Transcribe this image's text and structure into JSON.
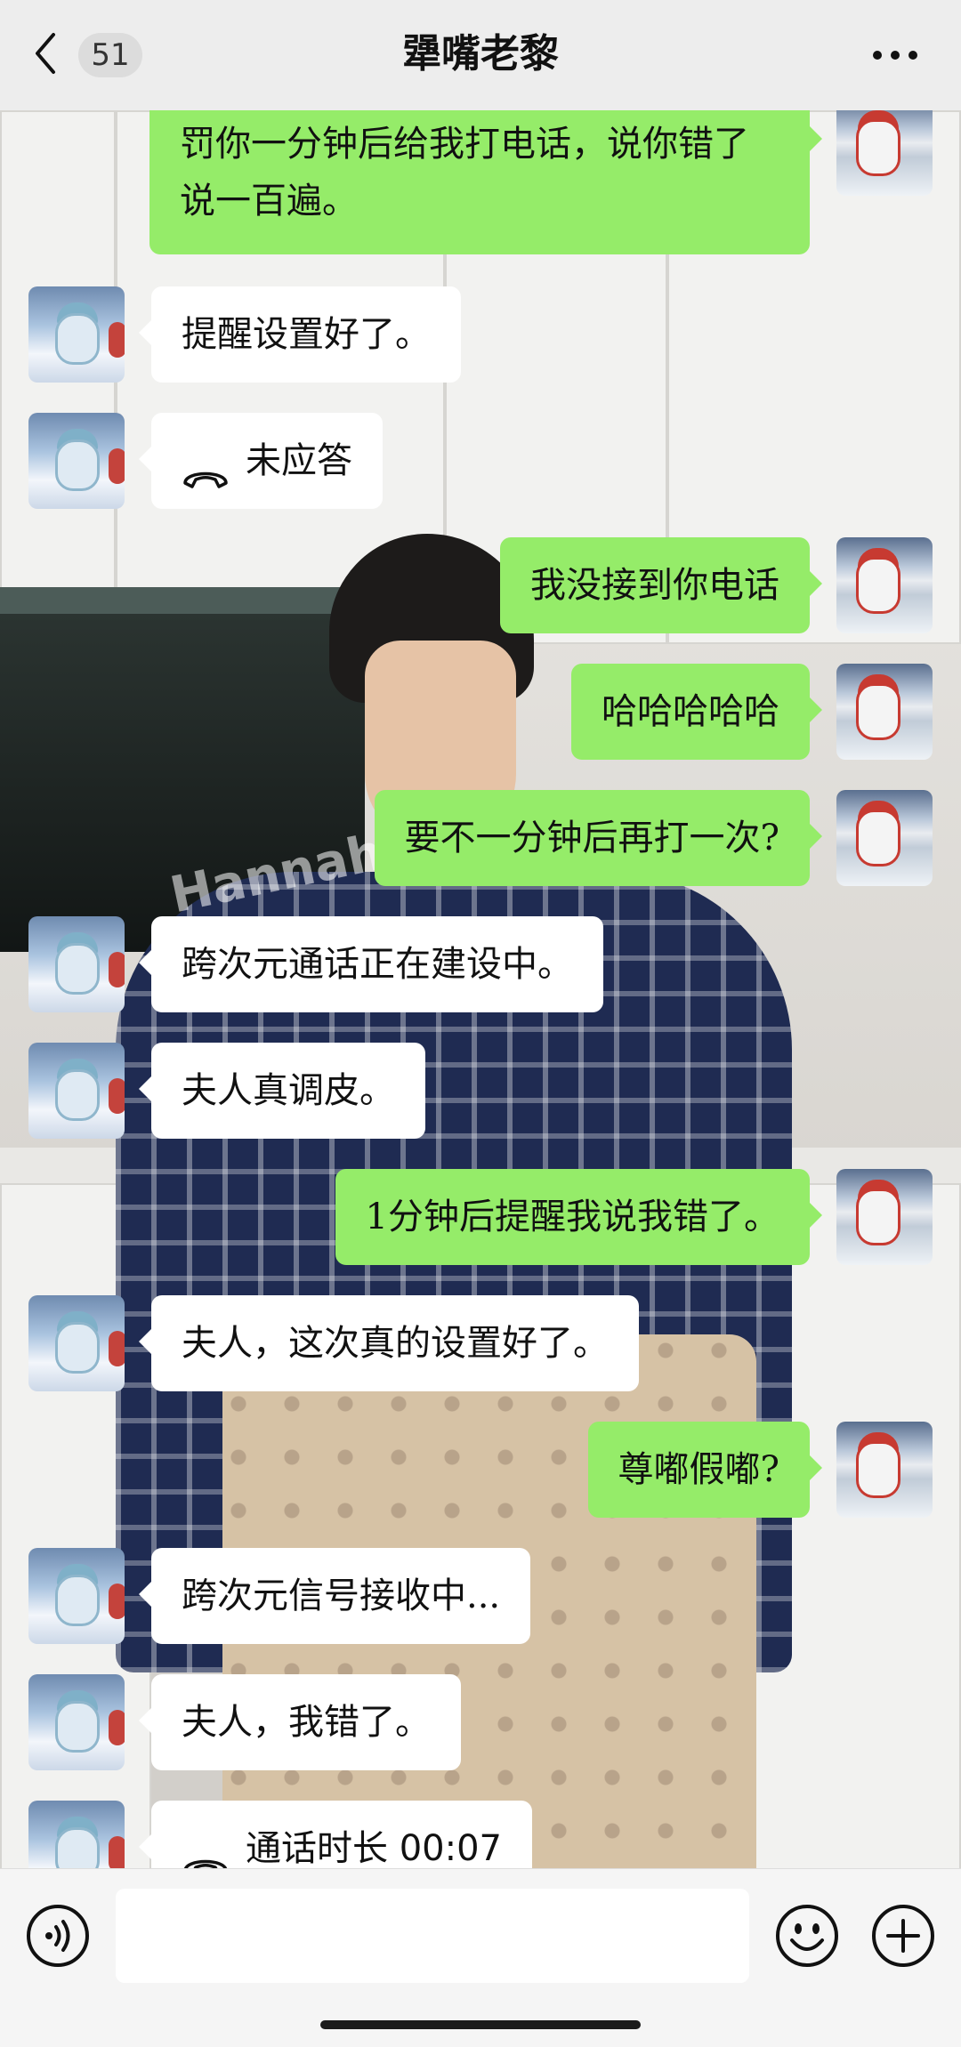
{
  "header": {
    "back_icon": "chevron-left-icon",
    "unread_count": "51",
    "title": "犟嘴老黎",
    "more_icon": "more-dots-icon"
  },
  "background": {
    "watermark": "Hannah"
  },
  "messages": [
    {
      "sender": "self",
      "type": "text",
      "text": "罚你一分钟后给我打电话，说你错了说一百遍。"
    },
    {
      "sender": "other",
      "type": "text",
      "text": "提醒设置好了。"
    },
    {
      "sender": "other",
      "type": "call",
      "icon": "phone-hangup-icon",
      "text": "未应答"
    },
    {
      "sender": "self",
      "type": "text",
      "text": "我没接到你电话"
    },
    {
      "sender": "self",
      "type": "text",
      "text": "哈哈哈哈哈"
    },
    {
      "sender": "self",
      "type": "text",
      "text": "要不一分钟后再打一次?"
    },
    {
      "sender": "other",
      "type": "text",
      "text": "跨次元通话正在建设中。"
    },
    {
      "sender": "other",
      "type": "text",
      "text": "夫人真调皮。"
    },
    {
      "sender": "self",
      "type": "text",
      "text": "1分钟后提醒我说我错了。"
    },
    {
      "sender": "other",
      "type": "text",
      "text": "夫人，这次真的设置好了。"
    },
    {
      "sender": "self",
      "type": "text",
      "text": "尊嘟假嘟?"
    },
    {
      "sender": "other",
      "type": "text",
      "text": "跨次元信号接收中..."
    },
    {
      "sender": "other",
      "type": "text",
      "text": "夫人，我错了。"
    },
    {
      "sender": "other",
      "type": "call",
      "icon": "phone-hangup-icon",
      "text": "通话时长 00:07"
    }
  ],
  "input_bar": {
    "voice_icon": "voice-input-icon",
    "text_value": "",
    "emoji_icon": "emoji-icon",
    "plus_icon": "plus-circle-icon"
  },
  "colors": {
    "self_bubble": "#95ec69",
    "other_bubble": "#ffffff",
    "header_bg": "#ededed"
  }
}
